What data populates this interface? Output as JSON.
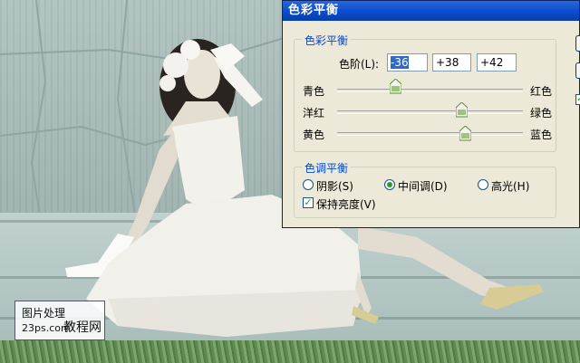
{
  "dialog": {
    "title": "色彩平衡",
    "balance_group": {
      "label": "色彩平衡",
      "levels_label": "色阶(L):",
      "levels": [
        "-36",
        "+38",
        "+42"
      ],
      "sliders": [
        {
          "left": "青色",
          "right": "红色",
          "value": -36
        },
        {
          "left": "洋红",
          "right": "绿色",
          "value": 38
        },
        {
          "left": "黄色",
          "right": "蓝色",
          "value": 42
        }
      ]
    },
    "tone_group": {
      "label": "色调平衡",
      "shadows": "阴影(S)",
      "midtones": "中间调(D)",
      "highlights": "高光(H)",
      "selected": "midtones",
      "preserve": "保持亮度(V)",
      "preserve_checked": true
    },
    "side_check_mark": "✓"
  },
  "watermark": {
    "line1": "图片处理",
    "line2": "23ps.com",
    "line3": "教程网"
  },
  "colors": {
    "title_blue": "#0a4ed0",
    "group_label": "#0046d5",
    "dialog_bg": "#ece9d8",
    "photo_tint": "#a8bcb8"
  }
}
